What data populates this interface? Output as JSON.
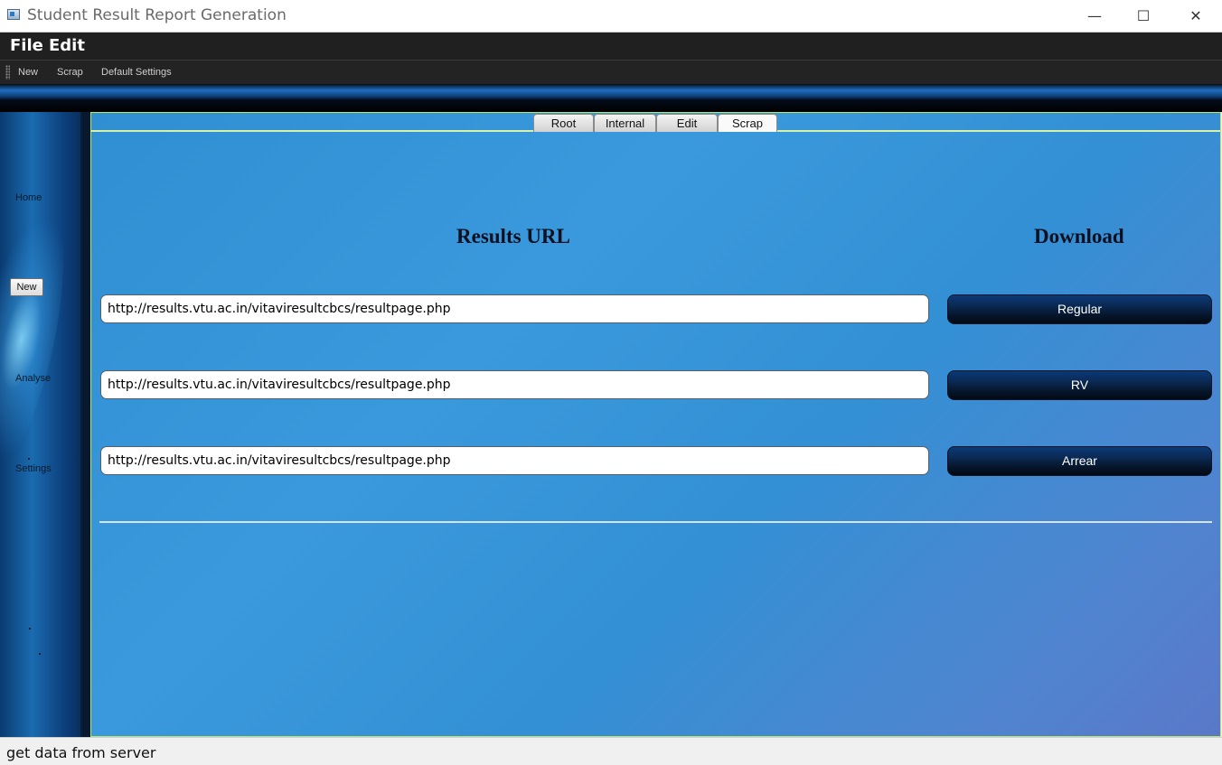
{
  "window": {
    "title": "Student Result Report Generation",
    "minimize_icon": "minimize-icon",
    "maximize_icon": "maximize-icon",
    "close_icon": "close-icon"
  },
  "menu": {
    "items": [
      "File",
      "Edit"
    ]
  },
  "toolbar": {
    "items": [
      "New",
      "Scrap",
      "Default Settings"
    ]
  },
  "sidebar": {
    "home": "Home",
    "new": "New",
    "analyse": "Analyse",
    "settings": "Settings"
  },
  "tabs": {
    "items": [
      "Root",
      "Internal",
      "Edit",
      "Scrap"
    ],
    "active": "Scrap"
  },
  "content": {
    "url_heading": "Results URL",
    "download_heading": "Download",
    "rows": [
      {
        "url": "http://results.vtu.ac.in/vitaviresultcbcs/resultpage.php",
        "button": "Regular"
      },
      {
        "url": "http://results.vtu.ac.in/vitaviresultcbcs/resultpage.php",
        "button": "RV"
      },
      {
        "url": "http://results.vtu.ac.in/vitaviresultcbcs/resultpage.php",
        "button": "Arrear"
      }
    ]
  },
  "status": {
    "text": "get data from server"
  }
}
